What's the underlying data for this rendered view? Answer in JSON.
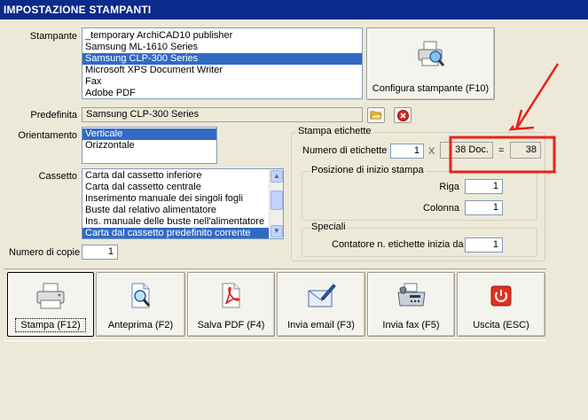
{
  "window": {
    "title": "IMPOSTAZIONE STAMPANTI"
  },
  "printers": {
    "label": "Stampante",
    "items": [
      "_temporary ArchiCAD10 publisher",
      "Samsung ML-1610 Series",
      "Samsung CLP-300 Series",
      "Microsoft XPS Document Writer",
      "Fax",
      "Adobe PDF"
    ],
    "selected": "Samsung CLP-300 Series"
  },
  "configure_button": {
    "label": "Configura stampante (F10)",
    "icon": "printer-config-icon"
  },
  "default_printer": {
    "label": "Predefinita",
    "value": "Samsung CLP-300 Series",
    "icons": [
      "folder-icon",
      "remove-icon"
    ]
  },
  "orientation": {
    "label": "Orientamento",
    "items": [
      "Verticale",
      "Orizzontale"
    ],
    "selected": "Verticale"
  },
  "tray": {
    "label": "Cassetto",
    "items": [
      "Carta dal cassetto inferiore",
      "Carta dal cassetto centrale",
      "Inserimento manuale dei singoli fogli",
      "Buste dal relativo alimentatore",
      "Ins. manuale delle buste nell'alimentatore",
      "Carta dal cassetto predefinito corrente"
    ],
    "selected": "Carta dal cassetto predefinito corrente"
  },
  "copies": {
    "label": "Numero di copie",
    "value": "1"
  },
  "labels_group": {
    "title": "Stampa etichette",
    "count_label": "Numero di etichette",
    "count_value": "1",
    "times": "X",
    "docs_value": "38 Doc.",
    "equals": "=",
    "total_value": "38",
    "start_group": {
      "title": "Posizione di inizio stampa",
      "row_label": "Riga",
      "row_value": "1",
      "col_label": "Colonna",
      "col_value": "1"
    },
    "special_group": {
      "title": "Speciali",
      "counter_label": "Contatore n. etichette inizia da",
      "counter_value": "1"
    }
  },
  "actions": [
    {
      "label": "Stampa (F12)",
      "icon": "printer-icon"
    },
    {
      "label": "Anteprima (F2)",
      "icon": "preview-icon"
    },
    {
      "label": "Salva PDF (F4)",
      "icon": "pdf-icon"
    },
    {
      "label": "Invia email (F3)",
      "icon": "email-icon"
    },
    {
      "label": "Invia fax (F5)",
      "icon": "fax-icon"
    },
    {
      "label": "Uscita (ESC)",
      "icon": "exit-icon"
    }
  ],
  "colors": {
    "title_bar": "#0a2a8c",
    "selection": "#316ac5",
    "annotation": "#e8221a",
    "face": "#ece9d8"
  }
}
